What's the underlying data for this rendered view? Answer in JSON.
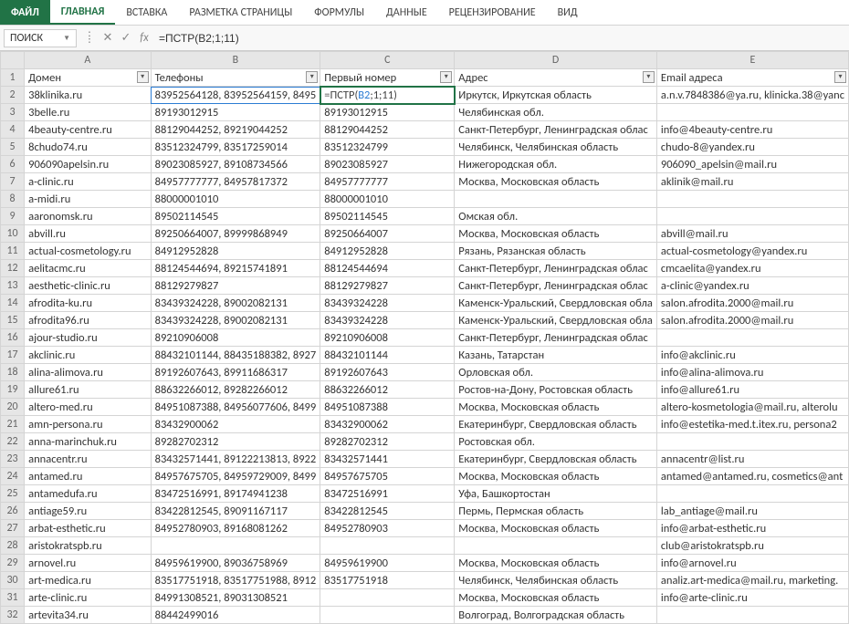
{
  "ribbon": {
    "file": "ФАЙЛ",
    "tabs": [
      "ГЛАВНАЯ",
      "ВСТАВКА",
      "РАЗМЕТКА СТРАНИЦЫ",
      "ФОРМУЛЫ",
      "ДАННЫЕ",
      "РЕЦЕНЗИРОВАНИЕ",
      "ВИД"
    ]
  },
  "formula_bar": {
    "name_box": "ПОИСК",
    "fx": "fx",
    "formula": "=ПСТР(B2;1;11)"
  },
  "columns": [
    "A",
    "B",
    "C",
    "D",
    "E"
  ],
  "headers": {
    "A": "Домен",
    "B": "Телефоны",
    "C": "Первый номер",
    "D": "Адрес",
    "E": "Email адреса"
  },
  "active_cell_display": "=ПСТР(B2;1;11)",
  "rows": [
    {
      "n": 2,
      "A": "38klinika.ru",
      "B": "83952564128, 83952564159, 8495",
      "C": "=ПСТР(B2;1;11)",
      "D": "Иркутск, Иркутская область",
      "E": "a.n.v.7848386@ya.ru, klinicka.38@yanc"
    },
    {
      "n": 3,
      "A": "3belle.ru",
      "B": "89193012915",
      "C": "89193012915",
      "D": "Челябинская обл.",
      "E": ""
    },
    {
      "n": 4,
      "A": "4beauty-centre.ru",
      "B": "88129044252, 89219044252",
      "C": "88129044252",
      "D": "Санкт-Петербург, Ленинградская облас",
      "E": "info@4beauty-centre.ru"
    },
    {
      "n": 5,
      "A": "8chudo74.ru",
      "B": "83512324799, 83517259014",
      "C": "83512324799",
      "D": "Челябинск, Челябинская область",
      "E": "chudo-8@yandex.ru"
    },
    {
      "n": 6,
      "A": "906090apelsin.ru",
      "B": "89023085927, 89108734566",
      "C": "89023085927",
      "D": "Нижегородская обл.",
      "E": "906090_apelsin@mail.ru"
    },
    {
      "n": 7,
      "A": "a-clinic.ru",
      "B": "84957777777, 84957817372",
      "C": "84957777777",
      "D": "Москва, Московская область",
      "E": "aklinik@mail.ru"
    },
    {
      "n": 8,
      "A": "a-midi.ru",
      "B": "88000001010",
      "C": "88000001010",
      "D": "",
      "E": ""
    },
    {
      "n": 9,
      "A": "aaronomsk.ru",
      "B": "89502114545",
      "C": "89502114545",
      "D": "Омская обл.",
      "E": ""
    },
    {
      "n": 10,
      "A": "abvill.ru",
      "B": "89250664007, 89999868949",
      "C": "89250664007",
      "D": "Москва, Московская область",
      "E": "abvill@mail.ru"
    },
    {
      "n": 11,
      "A": "actual-cosmetology.ru",
      "B": "84912952828",
      "C": "84912952828",
      "D": "Рязань, Рязанская область",
      "E": "actual-cosmetology@yandex.ru"
    },
    {
      "n": 12,
      "A": "aelitacmc.ru",
      "B": "88124544694, 89215741891",
      "C": "88124544694",
      "D": "Санкт-Петербург, Ленинградская облас",
      "E": "cmcaelita@yandex.ru"
    },
    {
      "n": 13,
      "A": "aesthetic-clinic.ru",
      "B": "88129279827",
      "C": "88129279827",
      "D": "Санкт-Петербург, Ленинградская облас",
      "E": "a-clinic@yandex.ru"
    },
    {
      "n": 14,
      "A": "afrodita-ku.ru",
      "B": "83439324228, 89002082131",
      "C": "83439324228",
      "D": "Каменск-Уральский, Свердловская обла",
      "E": "salon.afrodita.2000@mail.ru"
    },
    {
      "n": 15,
      "A": "afrodita96.ru",
      "B": "83439324228, 89002082131",
      "C": "83439324228",
      "D": "Каменск-Уральский, Свердловская обла",
      "E": "salon.afrodita.2000@mail.ru"
    },
    {
      "n": 16,
      "A": "ajour-studio.ru",
      "B": "89210906008",
      "C": "89210906008",
      "D": "Санкт-Петербург, Ленинградская облас",
      "E": ""
    },
    {
      "n": 17,
      "A": "akclinic.ru",
      "B": "88432101144, 88435188382, 8927",
      "C": "88432101144",
      "D": "Казань, Татарстан",
      "E": "info@akclinic.ru"
    },
    {
      "n": 18,
      "A": "alina-alimova.ru",
      "B": "89192607643, 89911686317",
      "C": "89192607643",
      "D": "Орловская обл.",
      "E": "info@alina-alimova.ru"
    },
    {
      "n": 19,
      "A": "allure61.ru",
      "B": "88632266012, 89282266012",
      "C": "88632266012",
      "D": "Ростов-на-Дону, Ростовская область",
      "E": "info@allure61.ru"
    },
    {
      "n": 20,
      "A": "altero-med.ru",
      "B": "84951087388, 84956077606, 8499",
      "C": "84951087388",
      "D": "Москва, Московская область",
      "E": "altero-kosmetologia@mail.ru, alterolu"
    },
    {
      "n": 21,
      "A": "amn-persona.ru",
      "B": "83432900062",
      "C": "83432900062",
      "D": "Екатеринбург, Свердловская область",
      "E": "info@estetika-med.t.itex.ru, persona2"
    },
    {
      "n": 22,
      "A": "anna-marinchuk.ru",
      "B": "89282702312",
      "C": "89282702312",
      "D": "Ростовская обл.",
      "E": ""
    },
    {
      "n": 23,
      "A": "annacentr.ru",
      "B": "83432571441, 89122213813, 8922",
      "C": "83432571441",
      "D": "Екатеринбург, Свердловская область",
      "E": "annacentr@list.ru"
    },
    {
      "n": 24,
      "A": "antamed.ru",
      "B": "84957675705, 84959729009, 8499",
      "C": "84957675705",
      "D": "Москва, Московская область",
      "E": "antamed@antamed.ru, cosmetics@ant"
    },
    {
      "n": 25,
      "A": "antamedufa.ru",
      "B": "83472516991, 89174941238",
      "C": "83472516991",
      "D": "Уфа, Башкортостан",
      "E": ""
    },
    {
      "n": 26,
      "A": "antiage59.ru",
      "B": "83422812545, 89091167117",
      "C": "83422812545",
      "D": "Пермь, Пермская область",
      "E": "lab_antiage@mail.ru"
    },
    {
      "n": 27,
      "A": "arbat-esthetic.ru",
      "B": "84952780903, 89168081262",
      "C": "84952780903",
      "D": "Москва, Московская область",
      "E": "info@arbat-esthetic.ru"
    },
    {
      "n": 28,
      "A": "aristokratspb.ru",
      "B": "",
      "C": "",
      "D": "",
      "E": "club@aristokratspb.ru"
    },
    {
      "n": 29,
      "A": "arnovel.ru",
      "B": "84959619900, 89036758969",
      "C": "84959619900",
      "D": "Москва, Московская область",
      "E": "info@arnovel.ru"
    },
    {
      "n": 30,
      "A": "art-medica.ru",
      "B": "83517751918, 83517751988, 8912",
      "C": "83517751918",
      "D": "Челябинск, Челябинская область",
      "E": "analiz.art-medica@mail.ru, marketing."
    },
    {
      "n": 31,
      "A": "arte-clinic.ru",
      "B": "84991308521, 89031308521",
      "C": "",
      "D": "Москва, Московская область",
      "E": "info@arte-clinic.ru"
    },
    {
      "n": 32,
      "A": "artevita34.ru",
      "B": "88442499016",
      "C": "",
      "D": "Волгоград, Волгоградская область",
      "E": ""
    }
  ]
}
